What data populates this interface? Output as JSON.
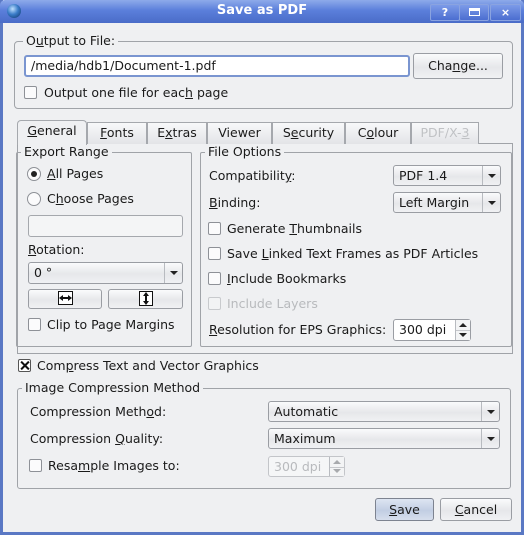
{
  "window": {
    "title": "Save as PDF",
    "help_label": "?",
    "close_label": "×"
  },
  "output": {
    "group_label_pre": "O",
    "group_label_u": "u",
    "group_label_post": "tput to File:",
    "file_path": "/media/hdb1/Document-1.pdf",
    "change_pre": "Cha",
    "change_u": "n",
    "change_post": "ge...",
    "one_file_pre": "Output one file for eac",
    "one_file_u": "h",
    "one_file_post": " page",
    "one_file_checked": false
  },
  "tabs": [
    {
      "pre": "",
      "u": "G",
      "post": "eneral",
      "active": true,
      "enabled": true
    },
    {
      "pre": "",
      "u": "F",
      "post": "onts",
      "active": false,
      "enabled": true
    },
    {
      "pre": "E",
      "u": "x",
      "post": "tras",
      "active": false,
      "enabled": true
    },
    {
      "pre": "Viewer",
      "u": "",
      "post": "",
      "active": false,
      "enabled": true
    },
    {
      "pre": "S",
      "u": "e",
      "post": "curity",
      "active": false,
      "enabled": true
    },
    {
      "pre": "C",
      "u": "o",
      "post": "lour",
      "active": false,
      "enabled": true
    },
    {
      "pre": "PDF/X-",
      "u": "3",
      "post": "",
      "active": false,
      "enabled": false
    }
  ],
  "export_range": {
    "group_label": "Export Range",
    "all_pages_u": "A",
    "all_pages_post": "ll Pages",
    "all_pages_selected": true,
    "choose_pages_pre": "C",
    "choose_pages_u": "h",
    "choose_pages_post": "oose Pages",
    "choose_pages_selected": false,
    "pages_value": "",
    "rotation_u": "R",
    "rotation_post": "otation:",
    "rotation_value": "0 °",
    "flip_horizontal_icon": "flip-horizontal-icon",
    "flip_vertical_icon": "flip-vertical-icon",
    "clip_margins_label": "Clip to Page Margins",
    "clip_margins_checked": false
  },
  "file_options": {
    "group_label": "File Options",
    "compatibility_pre": "Compatibilit",
    "compatibility_u": "y",
    "compatibility_post": ":",
    "compatibility_value": "PDF 1.4",
    "binding_u": "B",
    "binding_post": "inding:",
    "binding_value": "Left Margin",
    "thumbnails_pre": "Generate ",
    "thumbnails_u": "T",
    "thumbnails_post": "humbnails",
    "thumbnails_checked": false,
    "linked_pre": "Save ",
    "linked_u": "L",
    "linked_post": "inked Text Frames as PDF Articles",
    "linked_checked": false,
    "bookmarks_u": "I",
    "bookmarks_post": "nclude Bookmarks",
    "bookmarks_checked": false,
    "layers_label": "Include Layers",
    "layers_checked": false,
    "layers_enabled": false,
    "eps_u": "R",
    "eps_post": "esolution for EPS Graphics:",
    "eps_value": "300 dpi"
  },
  "compress_text": {
    "pre": "Com",
    "u": "p",
    "post": "ress Text and Vector Graphics",
    "checked": true
  },
  "image_compression": {
    "group_label": "Image Compression Method",
    "method_pre": "Compression Meth",
    "method_u": "o",
    "method_post": "d:",
    "method_value": "Automatic",
    "quality_pre": "Compression ",
    "quality_u": "Q",
    "quality_post": "uality:",
    "quality_value": "Maximum",
    "resample_pre": "Resa",
    "resample_u": "m",
    "resample_post": "ple Images to:",
    "resample_checked": false,
    "resample_value": "300 dpi",
    "resample_enabled": false
  },
  "footer": {
    "save_u": "S",
    "save_post": "ave",
    "cancel_u": "C",
    "cancel_post": "ancel"
  }
}
